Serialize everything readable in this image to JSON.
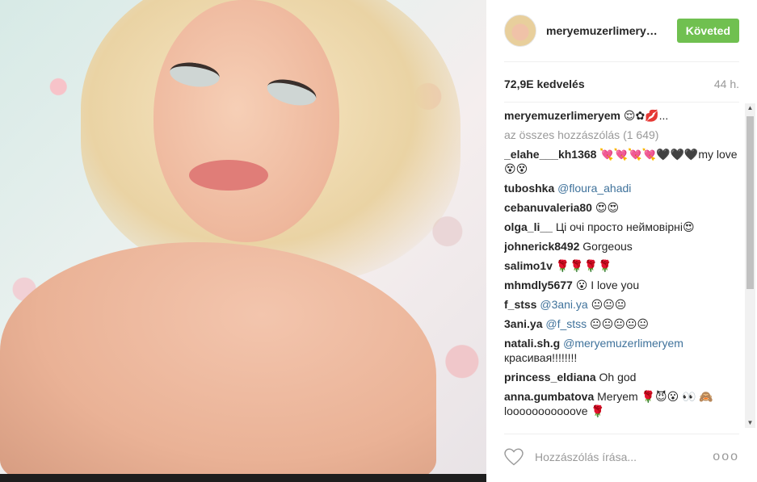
{
  "post": {
    "image_alt": "Selfie of a woman with blonde hair lying on floral bedding"
  },
  "header": {
    "username": "meryemuzerlimeryem",
    "follow_label": "Követed"
  },
  "stats": {
    "likes": "72,9E kedvelés",
    "time": "44 h."
  },
  "caption": {
    "user": "meryemuzerlimeryem",
    "text": "😌✿💋..."
  },
  "all_comments_label": "az összes hozzászólás (1 649)",
  "comments": [
    {
      "user": "_elahe___kh1368",
      "mention": "",
      "text": "💘💘💘💘🖤🖤🖤my love😵😵"
    },
    {
      "user": "tuboshka",
      "mention": "@floura_ahadi",
      "text": ""
    },
    {
      "user": "cebanuvaleria80",
      "mention": "",
      "text": "😍😍"
    },
    {
      "user": "olga_li__",
      "mention": "",
      "text": "Ці очі просто неймовірні😍"
    },
    {
      "user": "johnerick8492",
      "mention": "",
      "text": "Gorgeous"
    },
    {
      "user": "salimo1v",
      "mention": "",
      "text": "🌹🌹🌹🌹"
    },
    {
      "user": "mhmdly5677",
      "mention": "",
      "text": "😮 I love you"
    },
    {
      "user": "f_stss",
      "mention": "@3ani.ya",
      "text": "😐😐😐"
    },
    {
      "user": "3ani.ya",
      "mention": "@f_stss",
      "text": "😐😐😐😐😐"
    },
    {
      "user": "natali.sh.g",
      "mention": "@meryemuzerlimeryem",
      "text": "красивая!!!!!!!!"
    },
    {
      "user": "princess_eldiana",
      "mention": "",
      "text": "Oh god"
    },
    {
      "user": "anna.gumbatova",
      "mention": "",
      "text": "Meryem 🌹😈😮 👀 🙈 looooooooooove 🌹"
    }
  ],
  "footer": {
    "comment_placeholder": "Hozzászólás írása...",
    "more_label": "ooo"
  }
}
